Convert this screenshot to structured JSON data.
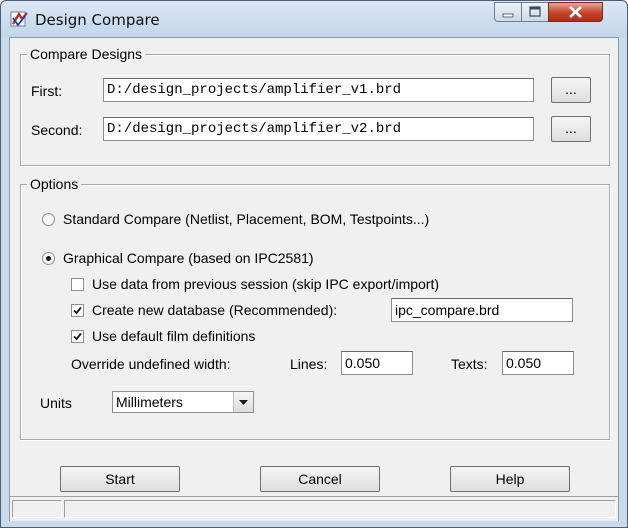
{
  "window": {
    "title": "Design Compare"
  },
  "compare_designs": {
    "label": "Compare Designs",
    "first_label": "First:",
    "first_value": "D:/design_projects/amplifier_v1.brd",
    "second_label": "Second:",
    "second_value": "D:/design_projects/amplifier_v2.brd",
    "browse_label": "..."
  },
  "options": {
    "label": "Options",
    "standard_label": "Standard Compare (Netlist, Placement, BOM, Testpoints...)",
    "graphical_label": "Graphical Compare (based on IPC2581)",
    "selected_mode": "graphical",
    "use_prev_label": "Use data from previous session (skip IPC export/import)",
    "use_prev_checked": false,
    "create_db_label": "Create new database (Recommended):",
    "create_db_checked": true,
    "db_name": "ipc_compare.brd",
    "film_label": "Use default film definitions",
    "film_checked": true,
    "override_label": "Override undefined width:",
    "lines_label": "Lines:",
    "lines_value": "0.050",
    "texts_label": "Texts:",
    "texts_value": "0.050",
    "units_label": "Units",
    "units_value": "Millimeters"
  },
  "buttons": {
    "start": "Start",
    "cancel": "Cancel",
    "help": "Help"
  },
  "colors": {
    "close_button": "#c4432a",
    "titlebar": "#c9daea",
    "dialog_bg": "#f0f0f0"
  }
}
